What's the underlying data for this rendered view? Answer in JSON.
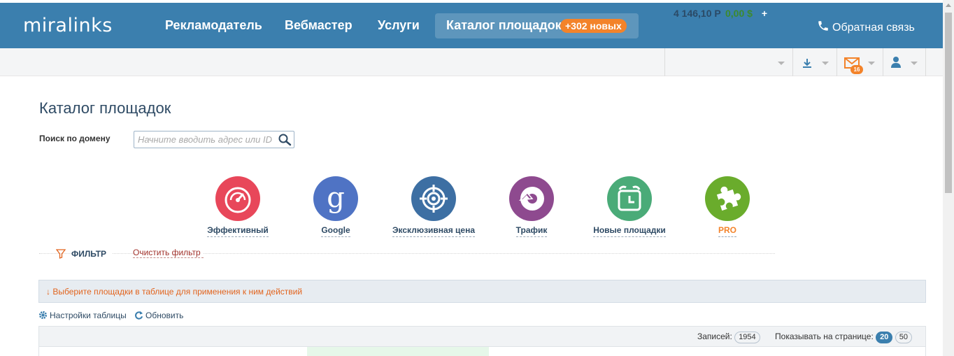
{
  "header": {
    "logo": "miralinks",
    "nav": [
      "Рекламодатель",
      "Вебмастер",
      "Услуги"
    ],
    "active_nav": "Каталог площадок",
    "new_badge": "+302 новых",
    "feedback": "Обратная связь"
  },
  "account": {
    "balance_rub": "4 146,10 Р",
    "balance_usd": "0,00 $",
    "messages_count": "16"
  },
  "page": {
    "title": "Каталог площадок",
    "search_label": "Поиск по домену",
    "search_placeholder": "Начните вводить адрес или ID"
  },
  "categories": [
    {
      "label": "Эффективный",
      "color": "#e8475a",
      "icon": "speedometer-icon"
    },
    {
      "label": "Google",
      "color": "#4f73c4",
      "icon": "google-g-icon"
    },
    {
      "label": "Эксклюзивная цена",
      "color": "#3d6fa3",
      "icon": "target-icon"
    },
    {
      "label": "Трафик",
      "color": "#8e4a8f",
      "icon": "traffic-pie-icon"
    },
    {
      "label": "Новые площадки",
      "color": "#4aab78",
      "icon": "alarm-clock-icon"
    },
    {
      "label": "PRO",
      "color": "#6aac2c",
      "icon": "puzzle-icon"
    }
  ],
  "filter": {
    "label": "ФИЛЬТР",
    "clear": "Очистить фильтр"
  },
  "info": {
    "text": "↓ Выберите площадки в таблице для применения к ним действий"
  },
  "tools": {
    "settings": "Настройки таблицы",
    "refresh": "Обновить"
  },
  "table": {
    "records_label": "Записей:",
    "records_count": "1954",
    "per_page_label": "Показывать на странице:",
    "per_page_options": [
      "20",
      "50"
    ],
    "per_page_selected": "20"
  },
  "colors": {
    "header_bg": "#3b7fae",
    "accent_orange": "#f3832a",
    "pro_label": "#f3832a"
  }
}
